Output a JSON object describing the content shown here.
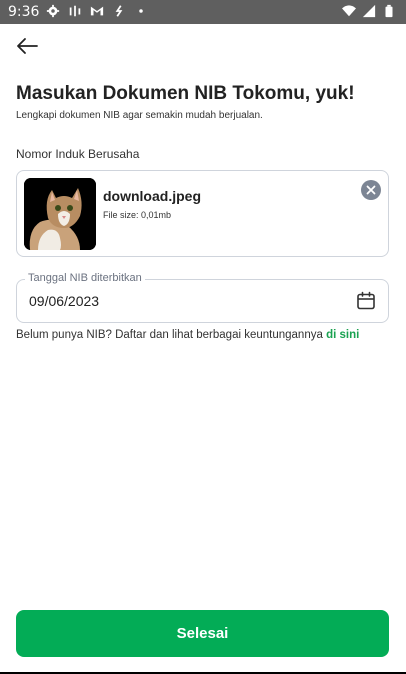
{
  "status_bar": {
    "time": "9:36",
    "left_icons": [
      "gear-icon",
      "signal-bars-icon",
      "gmail-icon",
      "sync-icon",
      "dot-icon"
    ],
    "right_icons": [
      "wifi-icon",
      "cellular-icon",
      "battery-icon"
    ]
  },
  "header": {
    "back_icon": "arrow-left-icon"
  },
  "page": {
    "title": "Masukan Dokumen NIB Tokomu, yuk!",
    "subtitle": "Lengkapi dokumen NIB agar semakin mudah berjualan."
  },
  "nib_field": {
    "label": "Nomor Induk Berusaha",
    "file_name": "download.jpeg",
    "file_size": "File size: 0,01mb",
    "remove_icon": "close-circle-icon"
  },
  "date_field": {
    "label": "Tanggal NIB diterbitkan",
    "value": "09/06/2023",
    "icon": "calendar-icon"
  },
  "info": {
    "text": "Belum punya NIB? Daftar dan lihat berbagai keuntungannya ",
    "link": "di sini"
  },
  "footer": {
    "submit_label": "Selesai"
  },
  "colors": {
    "accent": "#03ac56",
    "link": "#1aa251",
    "border": "#cfd4dc",
    "status_bar": "#5f5f5f"
  }
}
